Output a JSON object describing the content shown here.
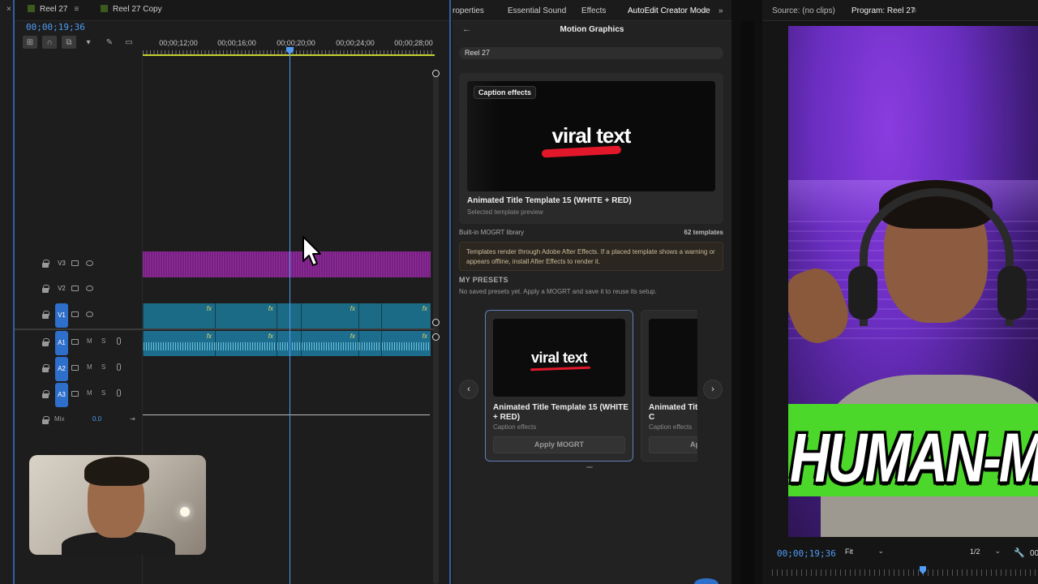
{
  "timeline": {
    "tabs": [
      {
        "label": "Reel 27",
        "menu": "≡"
      },
      {
        "label": "Reel 27 Copy"
      }
    ],
    "close_glyph": "×",
    "timecode": "00;00;19;36",
    "ruler_labels": [
      "00;00;12;00",
      "00;00;16;00",
      "00;00;20;00",
      "00;00;24;00",
      "00;00;28;00"
    ],
    "video_tracks": [
      {
        "name": "V3"
      },
      {
        "name": "V2"
      },
      {
        "name": "V1",
        "active": true
      }
    ],
    "audio_tracks": [
      {
        "name": "A1",
        "m": "M",
        "s": "S"
      },
      {
        "name": "A2",
        "m": "M",
        "s": "S"
      },
      {
        "name": "A3",
        "m": "M",
        "s": "S"
      }
    ],
    "mix": {
      "label": "Mix",
      "value": "0.0"
    },
    "fx_label": "fx"
  },
  "effects_panel": {
    "tabs": [
      "roperties",
      "Essential Sound",
      "Effects",
      "AutoEdit Creator Mode"
    ],
    "tab_menu": "≡",
    "overflow": "»",
    "back_glyph": "←",
    "title": "Motion Graphics",
    "sequence_label": "Reel 27",
    "preview": {
      "chip": "Caption effects",
      "thumb_text": "viral text",
      "name": "Animated Title Template 15 (WHITE + RED)",
      "subtitle": "Selected template preview"
    },
    "library_label": "Built-in MOGRT library",
    "library_count": "62 templates",
    "warning": "Templates render through Adobe After Effects. If a placed template shows a warning or appears offline, install After Effects to render it.",
    "presets_heading": "MY PRESETS",
    "presets_sub": "No saved presets yet. Apply a MOGRT and save it to reuse its setup.",
    "carousel": {
      "prev": "‹",
      "next": "›",
      "cards": [
        {
          "thumb_text": "viral text",
          "name": "Animated Title Template 15 (WHITE + RED)",
          "category": "Caption effects",
          "apply": "Apply MOGRT"
        },
        {
          "thumb_text": "",
          "name": "Animated Title Template (Vertical) - C",
          "category": "Caption effects",
          "apply": "Apply MOGRT"
        }
      ]
    }
  },
  "monitor": {
    "source_tab": "Source: (no clips)",
    "program_tab": "Program: Reel 27",
    "tab_menu": "≡",
    "caption_text": "HUMAN-M",
    "timecode": "00;00;19;36",
    "fit": "Fit",
    "resolution": "1/2",
    "extra_label": "00"
  },
  "colors": {
    "accent_blue": "#4f9cf5",
    "v3_clip": "#7a1e86",
    "v1_clip": "#1b6b86",
    "caption_band": "#4bd82a",
    "caption_red": "#e2182a"
  }
}
